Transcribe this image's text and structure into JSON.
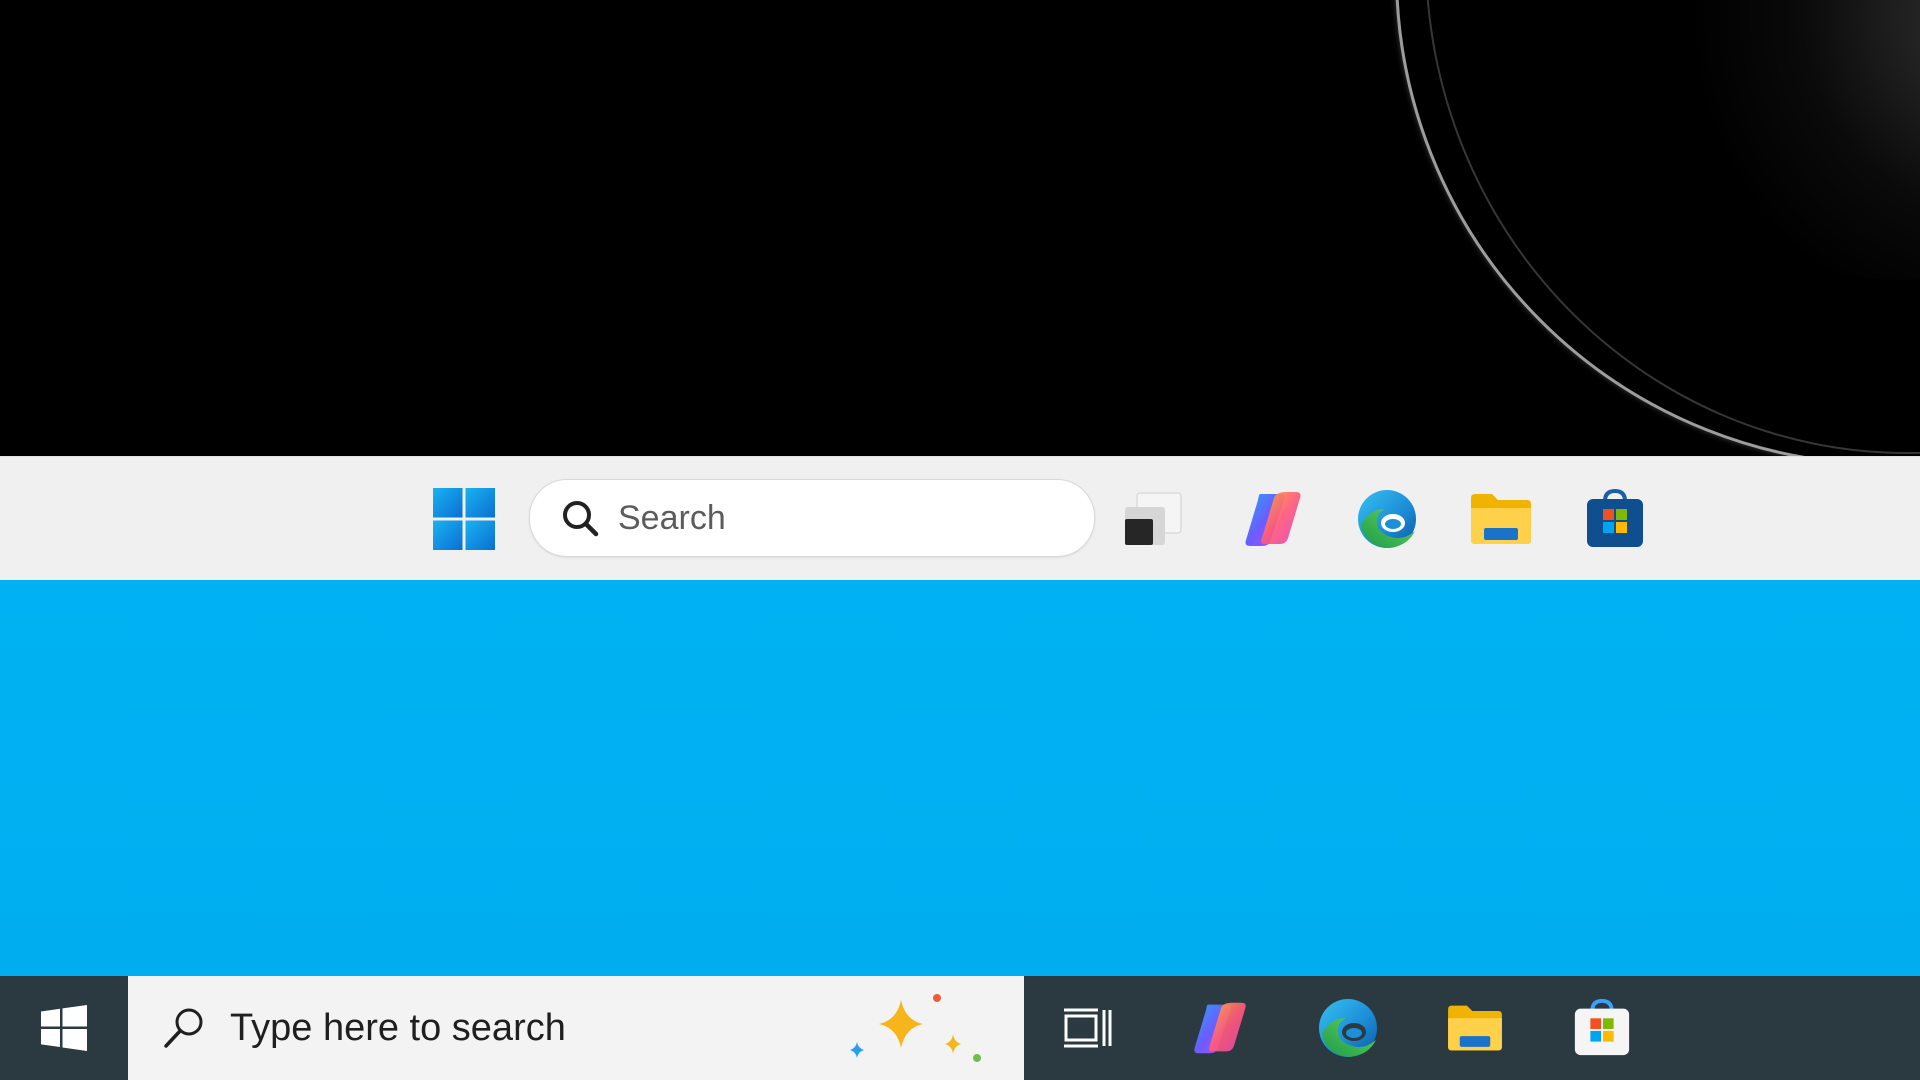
{
  "windows11_taskbar": {
    "search_placeholder": "Search",
    "items": [
      {
        "name": "start",
        "icon": "windows-11-logo-icon"
      },
      {
        "name": "task-view",
        "icon": "task-view-icon"
      },
      {
        "name": "copilot",
        "icon": "copilot-icon"
      },
      {
        "name": "edge",
        "icon": "edge-icon"
      },
      {
        "name": "file-explorer",
        "icon": "folder-icon"
      },
      {
        "name": "microsoft-store",
        "icon": "store-bag-icon"
      }
    ]
  },
  "windows10_taskbar": {
    "search_placeholder": "Type here to search",
    "items": [
      {
        "name": "start",
        "icon": "windows-10-logo-icon"
      },
      {
        "name": "task-view",
        "icon": "task-view-icon"
      },
      {
        "name": "copilot",
        "icon": "copilot-icon"
      },
      {
        "name": "edge",
        "icon": "edge-icon"
      },
      {
        "name": "file-explorer",
        "icon": "folder-icon"
      },
      {
        "name": "microsoft-store",
        "icon": "store-bag-icon"
      }
    ]
  },
  "colors": {
    "w11_taskbar_bg": "#f0f0f0",
    "w10_taskbar_bg": "#2b3a41",
    "blue_wallpaper": "#00b0f0",
    "windows_blue": "#1a9be6"
  }
}
